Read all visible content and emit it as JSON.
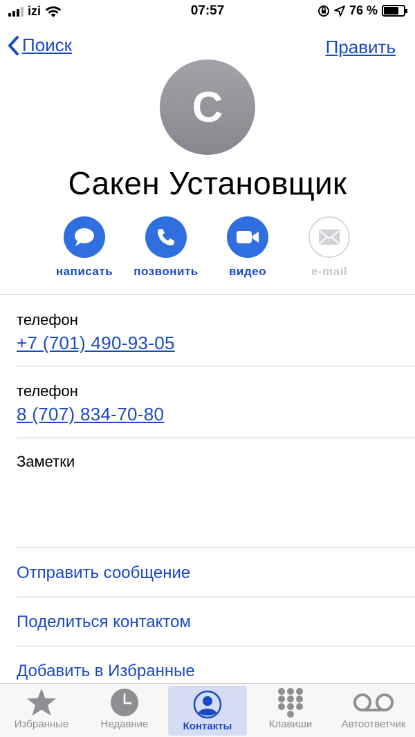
{
  "status_bar": {
    "carrier": "izi",
    "time": "07:57",
    "battery": "76 %",
    "battery_level": 0.76
  },
  "nav": {
    "back_label": "Поиск",
    "edit_label": "Править"
  },
  "contact": {
    "initial": "С",
    "name": "Сакен Установщик"
  },
  "actions": [
    {
      "label": "написать",
      "icon": "message-icon",
      "enabled": true
    },
    {
      "label": "позвонить",
      "icon": "phone-icon",
      "enabled": true
    },
    {
      "label": "видео",
      "icon": "video-icon",
      "enabled": true
    },
    {
      "label": "e-mail",
      "icon": "mail-icon",
      "enabled": false
    }
  ],
  "phones": [
    {
      "label": "телефон",
      "value": "+7 (701) 490-93-05"
    },
    {
      "label": "телефон",
      "value": "8 (707) 834-70-80"
    }
  ],
  "notes_label": "Заметки",
  "links": {
    "send_message": "Отправить сообщение",
    "share_contact": "Поделиться контактом",
    "add_favorites": "Добавить в Избранные"
  },
  "tabs": [
    {
      "label": "Избранные",
      "icon": "star-icon",
      "active": false
    },
    {
      "label": "Недавние",
      "icon": "clock-icon",
      "active": false
    },
    {
      "label": "Контакты",
      "icon": "contacts-icon",
      "active": true
    },
    {
      "label": "Клавиши",
      "icon": "keypad-icon",
      "active": false
    },
    {
      "label": "Автоответчик",
      "icon": "voicemail-icon",
      "active": false
    }
  ],
  "colors": {
    "accent": "#1a49c4",
    "button_blue": "#2f6fdf",
    "avatar_gray": "#96979c"
  }
}
